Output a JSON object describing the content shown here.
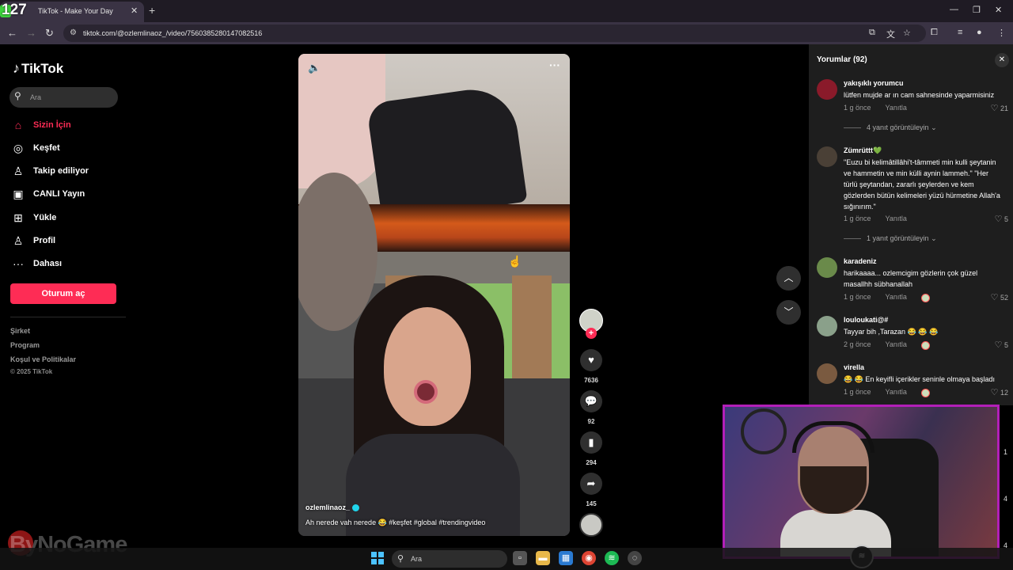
{
  "browser": {
    "tab_title": "TikTok - Make Your Day",
    "overlay_count": "127",
    "url": "tiktok.com/@ozlemlinaoz_/video/7560385280147082516"
  },
  "sidebar": {
    "logo": "TikTok",
    "search_placeholder": "Ara",
    "items": [
      {
        "label": "Sizin İçin",
        "icon": "home-icon"
      },
      {
        "label": "Keşfet",
        "icon": "compass-icon"
      },
      {
        "label": "Takip ediliyor",
        "icon": "user-icon"
      },
      {
        "label": "CANLI Yayın",
        "icon": "live-tv-icon"
      },
      {
        "label": "Yükle",
        "icon": "upload-plus-icon"
      },
      {
        "label": "Profil",
        "icon": "profile-icon"
      },
      {
        "label": "Dahası",
        "icon": "more-dots-icon"
      }
    ],
    "login": "Oturum aç",
    "footer": [
      "Şirket",
      "Program",
      "Koşul ve Politikalar"
    ],
    "copyright": "© 2025 TikTok",
    "watermark": "ByNoGame"
  },
  "video": {
    "author": "ozlemlinaoz_",
    "caption": "Ah nerede vah nerede 😂 #keşfet #global #trendingvideo"
  },
  "actions": {
    "likes": "7636",
    "comments": "92",
    "saves": "294",
    "shares": "145"
  },
  "comments_panel": {
    "title": "Yorumlar (92)",
    "reply_label": "Yanıtla",
    "items": [
      {
        "user": "yakışıklı yorumcu",
        "text": "lütfen mujde ar ın cam sahnesinde yaparmisiniz",
        "time": "1 g önce",
        "likes": "21",
        "avatar_color": "#8a1a2a",
        "replies": "4 yanıt görüntüleyin"
      },
      {
        "user": "Zümrüttt💚",
        "text": "\"Euzu bi kelimâtillâhi't-tâmmeti min kulli şeytanin ve hammetin ve min külli aynin lammeh.\" \"Her türlü şeytandan, zararlı şeylerden ve kem gözlerden bütün kelimeleri yüzü hürmetine Allah'a sığınırım.\"",
        "time": "1 g önce",
        "likes": "5",
        "avatar_color": "#4a4036",
        "replies": "1 yanıt görüntüleyin"
      },
      {
        "user": "karadeniz",
        "text": "harikaaaa... ozlemcigim gözlerin çok güzel masallhh sübhanallah",
        "time": "1 g önce",
        "likes": "52",
        "avatar_color": "#6a8a4a"
      },
      {
        "user": "louloukati@#",
        "text": "Tayyar bih ,Tarazan 😂 😂 😂",
        "time": "2 g önce",
        "likes": "5",
        "avatar_color": "#8aa08a"
      },
      {
        "user": "virella",
        "text": "😂 😂 En keyifli içerikler seninle olmaya başladı",
        "time": "1 g önce",
        "likes": "12",
        "avatar_color": "#7a5a40"
      }
    ]
  },
  "taskbar": {
    "search": "Ara"
  },
  "webcam": {
    "side_numbers": [
      "1",
      "4",
      "4"
    ]
  }
}
